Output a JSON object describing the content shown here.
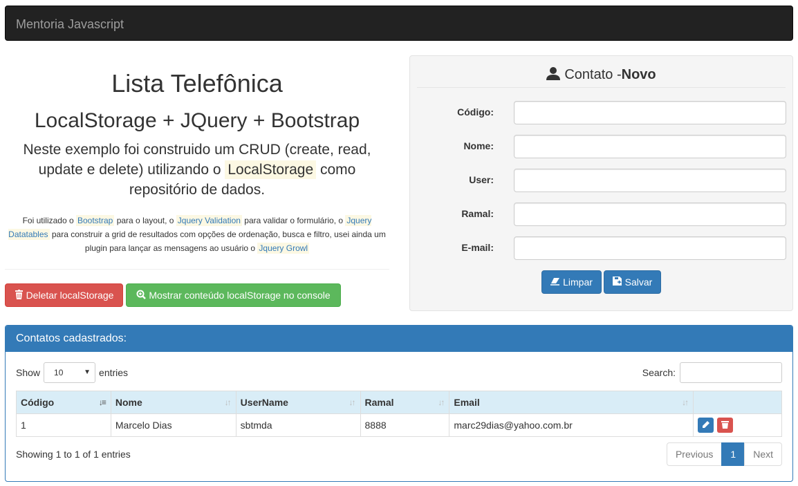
{
  "navbar": {
    "brand": "Mentoria Javascript"
  },
  "intro": {
    "title": "Lista Telefônica",
    "subtitle": "LocalStorage + JQuery + Bootstrap",
    "lead_1": "Neste exemplo foi construido um CRUD (create, read, update e delete) utilizando o",
    "lead_mark": "LocalStorage",
    "lead_2": "como repositório de dados.",
    "small_1": "Foi utilizado o",
    "bootstrap": "Bootstrap",
    "small_2": "para o layout, o",
    "jquery_validation": "Jquery Validation",
    "small_3": "para validar o formulário, o",
    "jquery_datatables": "Jquery Datatables",
    "small_4": "para construir a grid de resultados com opções de ordenação, busca e filtro, usei ainda um plugin para lançar as mensagens ao usuário o",
    "jquery_growl": "Jquery Growl"
  },
  "actions": {
    "delete_label": "Deletar localStorage",
    "show_label": "Mostrar conteúdo localStorage no console"
  },
  "form": {
    "legend_prefix": "Contato - ",
    "legend_mode": "Novo",
    "fields": {
      "codigo": "Código:",
      "nome": "Nome:",
      "user": "User:",
      "ramal": "Ramal:",
      "email": "E-mail:"
    },
    "clear_label": "Limpar",
    "save_label": "Salvar"
  },
  "panel": {
    "heading": "Contatos cadastrados:",
    "show": "Show",
    "entries_value": "10",
    "entries": "entries",
    "search": "Search:",
    "columns": [
      "Código",
      "Nome",
      "UserName",
      "Ramal",
      "Email"
    ],
    "rows": [
      {
        "codigo": "1",
        "nome": "Marcelo Dias",
        "username": "sbtmda",
        "ramal": "8888",
        "email": "marc29dias@yahoo.com.br"
      }
    ],
    "info": "Showing 1 to 1 of 1 entries",
    "pagination": {
      "previous": "Previous",
      "current": "1",
      "next": "Next"
    }
  },
  "colors": {
    "primary": "#337ab7",
    "danger": "#d9534f",
    "success": "#5cb85c",
    "navbar": "#222222"
  }
}
